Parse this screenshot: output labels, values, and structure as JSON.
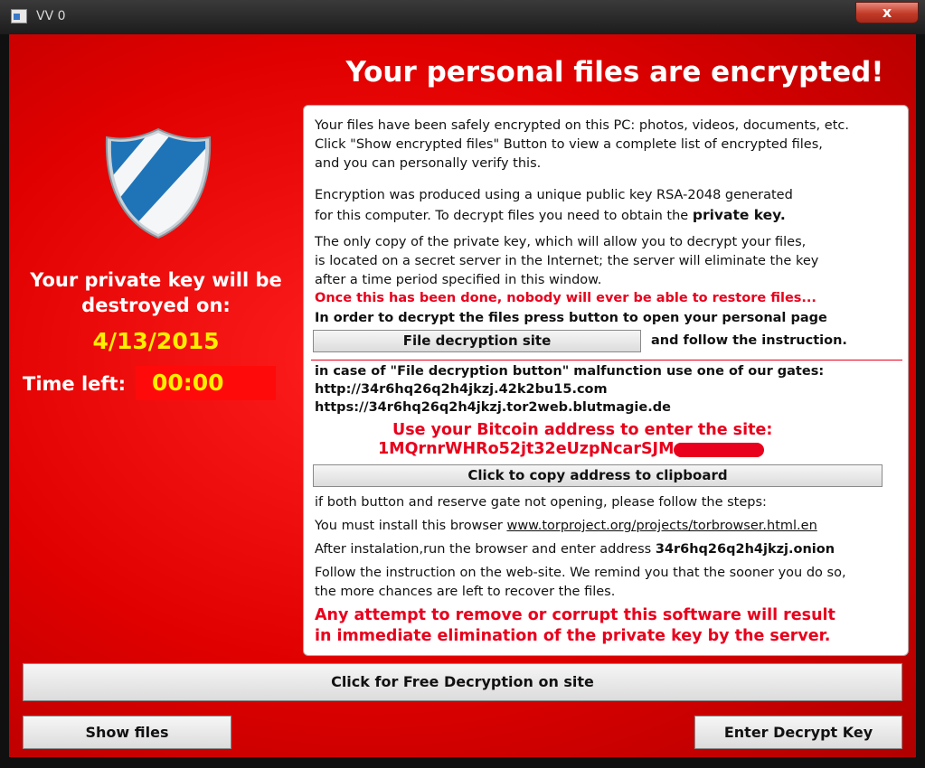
{
  "window": {
    "title": "VV 0",
    "close_label": "x"
  },
  "headline": "Your personal files are encrypted!",
  "left": {
    "key_destroyed_line1": "Your private key will be",
    "key_destroyed_line2": "destroyed on:",
    "date": "4/13/2015",
    "time_left_label": "Time left:",
    "time_left_value": "00:00"
  },
  "panel": {
    "p1": [
      "Your files have been safely encrypted on this PC: photos, videos, documents, etc.",
      "Click \"Show encrypted files\" Button to view a complete list of encrypted files,",
      "and you can personally verify this."
    ],
    "p2_line1": "Encryption was produced using a unique public key RSA-2048 generated",
    "p2_line2_pre": "for this computer. To decrypt files you need to obtain the ",
    "p2_line2_bold": "private key.",
    "p3": [
      "The only copy of the private key, which will allow you to decrypt your files,",
      "is located on a secret server in the Internet; the server will eliminate the key",
      "after a time period specified in this window."
    ],
    "warning": "Once this has been done, nobody will ever be able to restore files...",
    "instruction": "In order to decrypt the files press button to open your personal page",
    "site_button": "File decryption site",
    "follow": "and follow the instruction.",
    "gates_intro": "in case of \"File decryption button\" malfunction use one of our gates:",
    "gate1": "http://34r6hq26q2h4jkzj.42k2bu15.com",
    "gate2": "https://34r6hq26q2h4jkzj.tor2web.blutmagie.de",
    "bitcoin_prompt": "Use your Bitcoin address to  enter the site:",
    "bitcoin_address": "1MQrnrWHRo52jt32eUzpNcarSJM",
    "copy_button": "Click to copy address to clipboard",
    "steps_intro": "if both button and reserve gate not opening, please follow the steps:",
    "install_pre": "You must install this browser ",
    "install_link": "www.torproject.org/projects/torbrowser.html.en",
    "after_pre": "After instalation,run the browser and enter address ",
    "after_addr": "34r6hq26q2h4jkzj.onion",
    "follow_site": [
      "Follow the instruction on the web-site. We remind you that the sooner you do so,",
      "the more chances are left to recover the files."
    ],
    "final_warning": [
      "Any attempt to remove or corrupt this software will result",
      "in immediate elimination of the private key by the server."
    ]
  },
  "buttons": {
    "free_decryption": "Click for Free Decryption on site",
    "show_files": "Show files",
    "enter_key": "Enter Decrypt Key"
  },
  "colors": {
    "background_red": "#e00000",
    "accent_yellow": "#ffee00",
    "text_red": "#e8001c"
  },
  "icons": {
    "logo": "shield-icon",
    "app": "app-window-icon"
  }
}
